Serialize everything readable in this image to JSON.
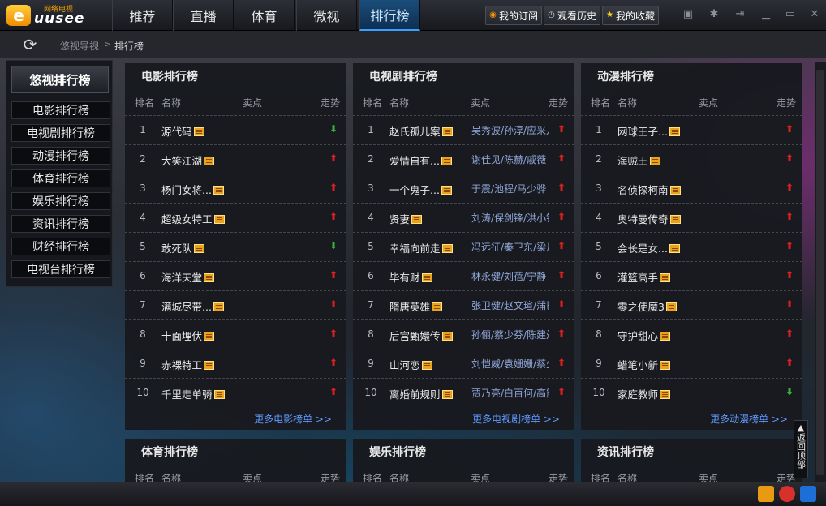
{
  "app": {
    "logo_letter": "e",
    "logo_text": "uusee",
    "logo_sub": "网络电视"
  },
  "nav": {
    "tabs": [
      "推荐",
      "直播",
      "体育",
      "微视",
      "排行榜"
    ],
    "active_index": 4
  },
  "toolbar": {
    "subscribe": "我的订阅",
    "history": "观看历史",
    "favorites": "我的收藏"
  },
  "breadcrumb": {
    "root": "悠视导视",
    "separator": ">",
    "current": "排行榜"
  },
  "sidebar": {
    "title": "悠视排行榜",
    "items": [
      "电影排行榜",
      "电视剧排行榜",
      "动漫排行榜",
      "体育排行榜",
      "娱乐排行榜",
      "资讯排行榜",
      "财经排行榜",
      "电视台排行榜"
    ]
  },
  "columns": {
    "rank": "排名",
    "name": "名称",
    "selling": "卖点",
    "trend": "走势"
  },
  "panels": [
    {
      "title": "电影排行榜",
      "more": "更多电影榜单  >>",
      "rows": [
        {
          "rank": "1",
          "name": "源代码",
          "actor": "",
          "trend": "down"
        },
        {
          "rank": "2",
          "name": "大笑江湖",
          "actor": "",
          "trend": "up"
        },
        {
          "rank": "3",
          "name": "杨门女将...",
          "actor": "",
          "trend": "up"
        },
        {
          "rank": "4",
          "name": "超级女特工",
          "actor": "",
          "trend": "up"
        },
        {
          "rank": "5",
          "name": "敢死队",
          "actor": "",
          "trend": "down"
        },
        {
          "rank": "6",
          "name": "海洋天堂",
          "actor": "",
          "trend": "up"
        },
        {
          "rank": "7",
          "name": "满城尽带...",
          "actor": "",
          "trend": "up"
        },
        {
          "rank": "8",
          "name": "十面埋伏",
          "actor": "",
          "trend": "up"
        },
        {
          "rank": "9",
          "name": "赤裸特工",
          "actor": "",
          "trend": "up"
        },
        {
          "rank": "10",
          "name": "千里走单骑",
          "actor": "",
          "trend": "up"
        }
      ]
    },
    {
      "title": "电视剧排行榜",
      "more": "更多电视剧榜单  >>",
      "rows": [
        {
          "rank": "1",
          "name": "赵氏孤儿案",
          "actor": "吴秀波/孙淳/应采儿",
          "trend": "up"
        },
        {
          "rank": "2",
          "name": "爱情自有...",
          "actor": "谢佳见/陈赫/戚薇",
          "trend": "up"
        },
        {
          "rank": "3",
          "name": "一个鬼子...",
          "actor": "于震/池程/马少骅",
          "trend": "up"
        },
        {
          "rank": "4",
          "name": "贤妻",
          "actor": "刘涛/保剑锋/洪小铃",
          "trend": "up"
        },
        {
          "rank": "5",
          "name": "幸福向前走",
          "actor": "冯远征/秦卫东/梁丹妮",
          "trend": "up"
        },
        {
          "rank": "6",
          "name": "毕有财",
          "actor": "林永健/刘蓓/宁静",
          "trend": "up"
        },
        {
          "rank": "7",
          "name": "隋唐英雄",
          "actor": "张卫健/赵文瑄/蒲巴甲",
          "trend": "up"
        },
        {
          "rank": "8",
          "name": "后宫甄嬛传",
          "actor": "孙俪/蔡少芬/陈建斌",
          "trend": "up"
        },
        {
          "rank": "9",
          "name": "山河恋",
          "actor": "刘恺威/袁姗姗/蔡少芬",
          "trend": "up"
        },
        {
          "rank": "10",
          "name": "离婚前规则",
          "actor": "贾乃亮/白百何/高露",
          "trend": "up"
        }
      ]
    },
    {
      "title": "动漫排行榜",
      "more": "更多动漫榜单  >>",
      "rows": [
        {
          "rank": "1",
          "name": "网球王子...",
          "actor": "",
          "trend": "up"
        },
        {
          "rank": "2",
          "name": "海贼王",
          "actor": "",
          "trend": "up"
        },
        {
          "rank": "3",
          "name": "名侦探柯南",
          "actor": "",
          "trend": "up"
        },
        {
          "rank": "4",
          "name": "奥特曼传奇",
          "actor": "",
          "trend": "up"
        },
        {
          "rank": "5",
          "name": "会长是女...",
          "actor": "",
          "trend": "up"
        },
        {
          "rank": "6",
          "name": "灌篮高手",
          "actor": "",
          "trend": "up"
        },
        {
          "rank": "7",
          "name": "零之使魔3",
          "actor": "",
          "trend": "up"
        },
        {
          "rank": "8",
          "name": "守护甜心",
          "actor": "",
          "trend": "up"
        },
        {
          "rank": "9",
          "name": "蜡笔小新",
          "actor": "",
          "trend": "up"
        },
        {
          "rank": "10",
          "name": "家庭教师",
          "actor": "",
          "trend": "down"
        }
      ]
    }
  ],
  "lower_panels": [
    {
      "title": "体育排行榜"
    },
    {
      "title": "娱乐排行榜"
    },
    {
      "title": "资讯排行榜"
    }
  ],
  "backtop": {
    "label": "返回顶部"
  },
  "trend_icons": {
    "up": "red-up-arrow-icon",
    "down": "green-down-arrow-icon"
  },
  "colors": {
    "accent": "#1a4d7a",
    "link": "#5f9aff",
    "up": "#e02020",
    "down": "#3cb43c",
    "logo": "#f5a400"
  }
}
